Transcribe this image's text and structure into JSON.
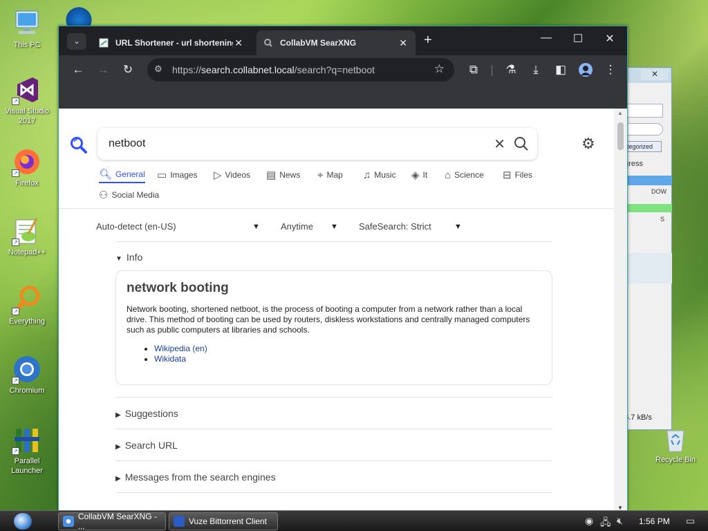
{
  "desktop": {
    "icons": [
      {
        "label": "This PC"
      },
      {
        "label": "Visual Studio 2017"
      },
      {
        "label": "Firefox"
      },
      {
        "label": "Notepad++"
      },
      {
        "label": "Everything"
      },
      {
        "label": "Chromium"
      },
      {
        "label": "Parallel Launcher"
      }
    ],
    "recycle_bin": "Recycle Bin"
  },
  "background_window": {
    "fragments": [
      "ategorized",
      "ogress",
      "DOW",
      "S",
      "3",
      "36.7 kB/s"
    ]
  },
  "browser": {
    "tabs": [
      {
        "title": "URL Shortener - url shortening",
        "active": false
      },
      {
        "title": "CollabVM SearXNG",
        "active": true
      }
    ],
    "url": {
      "scheme": "https://",
      "host": "search.collabnet.local",
      "path": "/search?q=netboot"
    }
  },
  "search": {
    "query": "netboot",
    "categories": [
      {
        "label": "General",
        "icon": "search-icon",
        "active": true
      },
      {
        "label": "Images",
        "icon": "image-icon"
      },
      {
        "label": "Videos",
        "icon": "play-icon"
      },
      {
        "label": "News",
        "icon": "newspaper-icon"
      },
      {
        "label": "Map",
        "icon": "map-pin-icon"
      },
      {
        "label": "Music",
        "icon": "music-icon"
      },
      {
        "label": "It",
        "icon": "layers-icon"
      },
      {
        "label": "Science",
        "icon": "graduation-cap-icon"
      },
      {
        "label": "Files",
        "icon": "inbox-icon"
      },
      {
        "label": "Social Media",
        "icon": "people-icon"
      }
    ],
    "filters": {
      "language": "Auto-detect (en-US)",
      "time": "Anytime",
      "safesearch": "SafeSearch: Strict"
    },
    "info_section": "Info",
    "infobox": {
      "title": "network booting",
      "text": "Network booting, shortened netboot, is the process of booting a computer from a network rather than a local drive. This method of booting can be used by routers, diskless workstations and centrally managed computers such as public computers at libraries and schools.",
      "links": [
        "Wikipedia (en)",
        "Wikidata"
      ]
    },
    "sections": [
      "Suggestions",
      "Search URL",
      "Messages from the search engines"
    ]
  },
  "taskbar": {
    "buttons": [
      "CollabVM SearXNG - ...",
      "Vuze Bittorrent Client"
    ],
    "time": "1:56 PM"
  },
  "colors": {
    "accent": "#3050ff",
    "link": "#1a3e9a",
    "chrome_dark": "#202124"
  }
}
